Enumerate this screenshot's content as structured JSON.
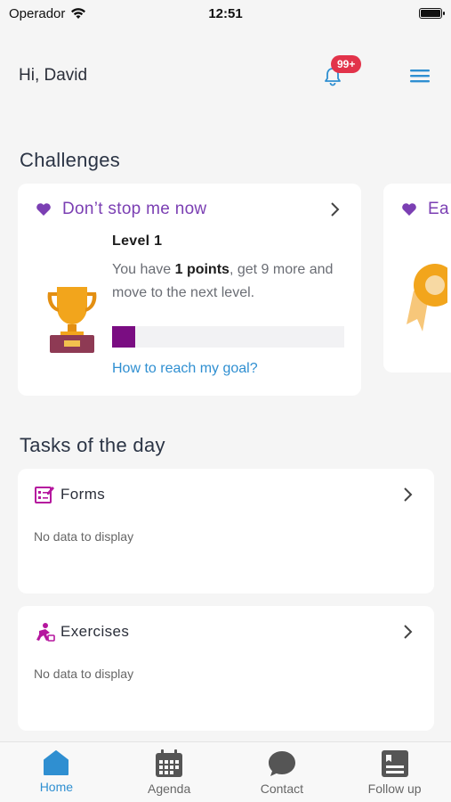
{
  "status_bar": {
    "carrier": "Operador",
    "time": "12:51"
  },
  "header": {
    "greeting": "Hi, David",
    "notification_badge": "99+"
  },
  "sections": {
    "challenges_title": "Challenges",
    "tasks_title": "Tasks of the day"
  },
  "challenge": {
    "title": "Don’t stop me now",
    "level": "Level 1",
    "desc_prefix": "You have ",
    "points": "1 points",
    "desc_suffix": ", get 9 more and move to the next level.",
    "progress_fraction": 0.1,
    "progress_color": "#7a0d82",
    "goal_link": "How to reach my goal?"
  },
  "challenge_partial": {
    "title": "Ea"
  },
  "tasks": [
    {
      "title": "Forms",
      "empty": "No data to display",
      "icon": "forms-icon"
    },
    {
      "title": "Exercises",
      "empty": "No data to display",
      "icon": "exercises-icon"
    }
  ],
  "nav": [
    {
      "label": "Home",
      "icon": "home-icon",
      "active": true
    },
    {
      "label": "Agenda",
      "icon": "calendar-icon",
      "active": false
    },
    {
      "label": "Contact",
      "icon": "chat-icon",
      "active": false
    },
    {
      "label": "Follow up",
      "icon": "follow-up-icon",
      "active": false
    }
  ],
  "colors": {
    "accent": "#2f8fd1",
    "challenge_purple": "#7b3fb3",
    "badge_red": "#e2334a",
    "task_icon_magenta": "#b5179e"
  }
}
